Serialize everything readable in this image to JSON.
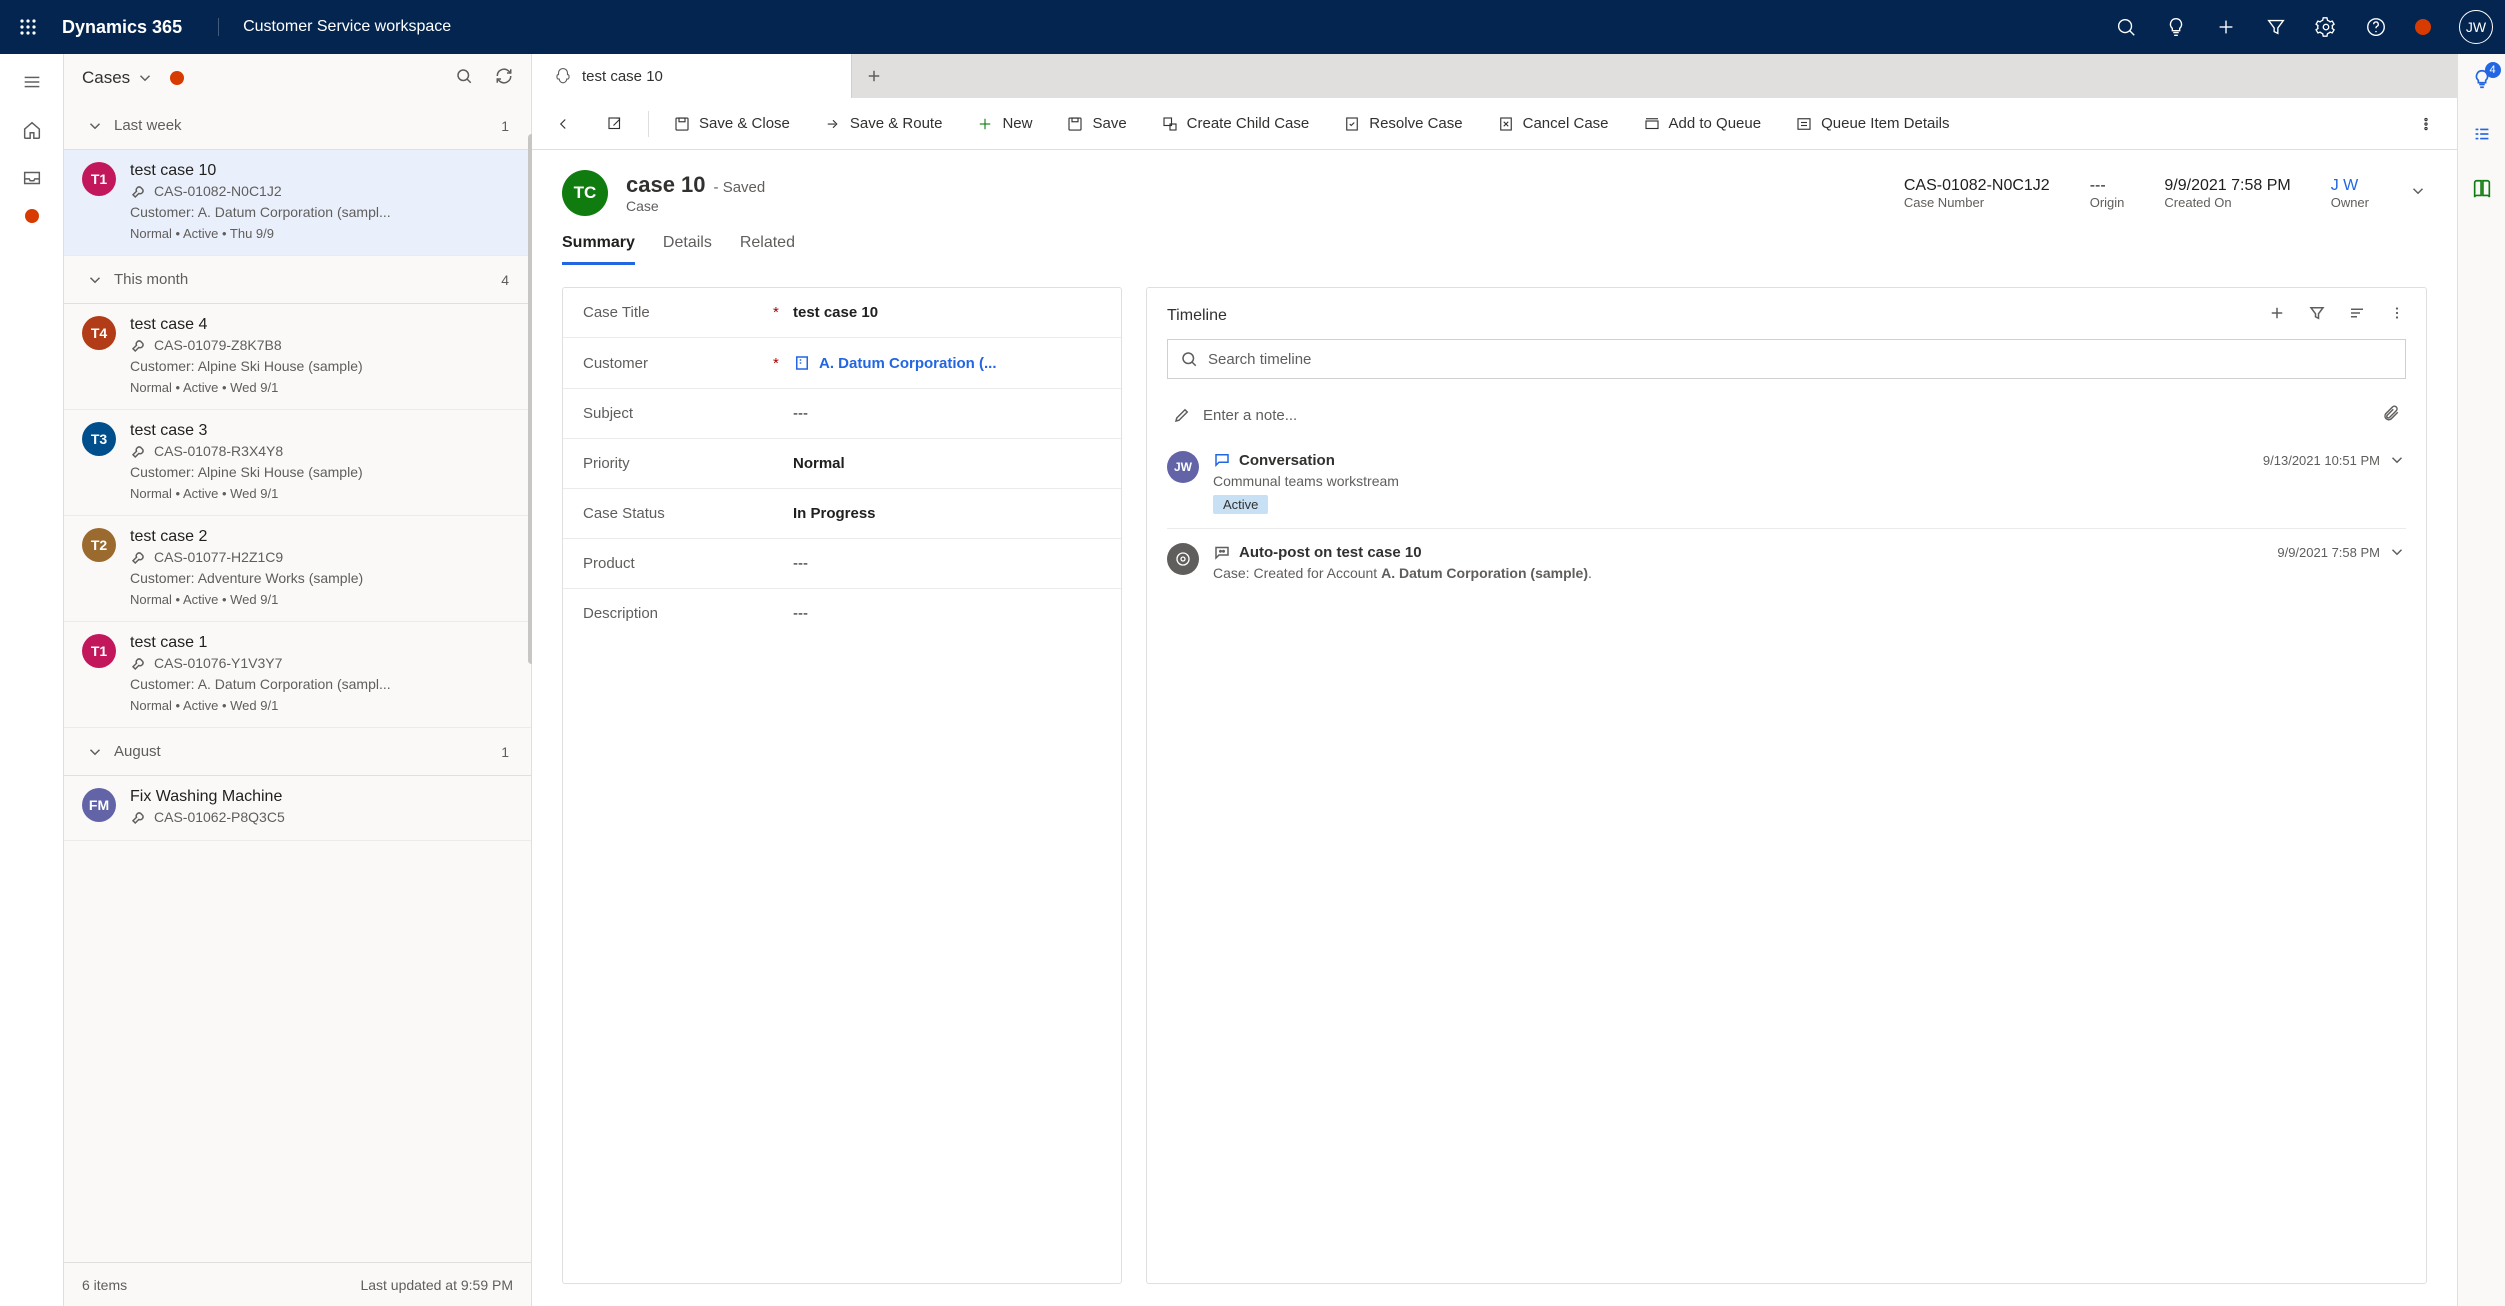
{
  "header": {
    "brand": "Dynamics 365",
    "appName": "Customer Service workspace",
    "userInitials": "JW"
  },
  "sidebar": {
    "title": "Cases",
    "footer_count": "6 items",
    "footer_updated": "Last updated at 9:59 PM",
    "groups": [
      {
        "label": "Last week",
        "count": "1",
        "items": [
          {
            "initials": "T1",
            "color": "#c2185b",
            "title": "test case 10",
            "case": "CAS-01082-N0C1J2",
            "customer": "Customer: A. Datum Corporation (sampl...",
            "meta": "Normal • Active • Thu 9/9",
            "selected": true
          }
        ]
      },
      {
        "label": "This month",
        "count": "4",
        "items": [
          {
            "initials": "T4",
            "color": "#b23c17",
            "title": "test case 4",
            "case": "CAS-01079-Z8K7B8",
            "customer": "Customer: Alpine Ski House (sample)",
            "meta": "Normal • Active • Wed 9/1"
          },
          {
            "initials": "T3",
            "color": "#004e8c",
            "title": "test case 3",
            "case": "CAS-01078-R3X4Y8",
            "customer": "Customer: Alpine Ski House (sample)",
            "meta": "Normal • Active • Wed 9/1"
          },
          {
            "initials": "T2",
            "color": "#9b6a2f",
            "title": "test case 2",
            "case": "CAS-01077-H2Z1C9",
            "customer": "Customer: Adventure Works (sample)",
            "meta": "Normal • Active • Wed 9/1"
          },
          {
            "initials": "T1",
            "color": "#c2185b",
            "title": "test case 1",
            "case": "CAS-01076-Y1V3Y7",
            "customer": "Customer: A. Datum Corporation (sampl...",
            "meta": "Normal • Active • Wed 9/1"
          }
        ]
      },
      {
        "label": "August",
        "count": "1",
        "items": [
          {
            "initials": "FM",
            "color": "#6264a7",
            "title": "Fix Washing Machine",
            "case": "CAS-01062-P8Q3C5",
            "customer": "",
            "meta": ""
          }
        ]
      }
    ]
  },
  "tabs": {
    "active": "test case 10"
  },
  "commands": {
    "save_close": "Save & Close",
    "save_route": "Save & Route",
    "new": "New",
    "save": "Save",
    "child": "Create Child Case",
    "resolve": "Resolve Case",
    "cancel": "Cancel Case",
    "queue": "Add to Queue",
    "qdetail": "Queue Item Details"
  },
  "record": {
    "avatar": "TC",
    "title": "case 10",
    "saved": "- Saved",
    "subtitle": "Case",
    "stats": {
      "caseno_v": "CAS-01082-N0C1J2",
      "caseno_l": "Case Number",
      "origin_v": "---",
      "origin_l": "Origin",
      "created_v": "9/9/2021 7:58 PM",
      "created_l": "Created On",
      "owner_v": "J W",
      "owner_l": "Owner"
    },
    "tabs": {
      "summary": "Summary",
      "details": "Details",
      "related": "Related"
    },
    "fields": {
      "title_l": "Case Title",
      "title_v": "test case 10",
      "customer_l": "Customer",
      "customer_v": "A. Datum Corporation (...",
      "subject_l": "Subject",
      "subject_v": "---",
      "priority_l": "Priority",
      "priority_v": "Normal",
      "status_l": "Case Status",
      "status_v": "In Progress",
      "product_l": "Product",
      "product_v": "---",
      "desc_l": "Description",
      "desc_v": "---"
    }
  },
  "timeline": {
    "title": "Timeline",
    "search_ph": "Search timeline",
    "note_ph": "Enter a note...",
    "items": [
      {
        "av": "JW",
        "avcolor": "#6264a7",
        "title": "Conversation",
        "desc": "Communal teams workstream",
        "pill": "Active",
        "time": "9/13/2021 10:51 PM",
        "icon": "chat"
      },
      {
        "av": "",
        "avcolor": "#605e5c",
        "title": "Auto-post on test case 10",
        "desc": "Case: Created for Account A. Datum Corporation (sample).",
        "time": "9/9/2021 7:58 PM",
        "icon": "bot"
      }
    ],
    "smart_badge": "4"
  }
}
